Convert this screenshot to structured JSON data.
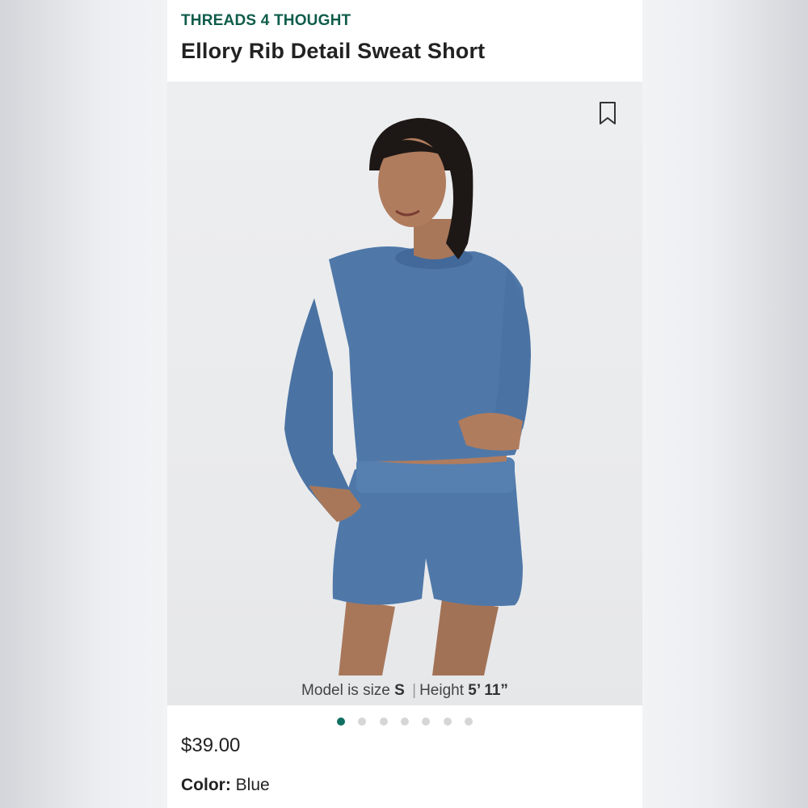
{
  "product": {
    "brand": "THREADS 4 THOUGHT",
    "title": "Ellory Rib Detail Sweat Short",
    "price": "$39.00",
    "color_label": "Color:",
    "color_value": "Blue"
  },
  "image": {
    "model_size_label": "Model is size",
    "model_size_value": "S",
    "separator": "|",
    "height_label": "Height",
    "height_value": "5’ 11”"
  },
  "carousel": {
    "total": 7,
    "active_index": 0
  },
  "icons": {
    "save": "bookmark-icon"
  },
  "colors": {
    "brand": "#0f5c4b",
    "active_dot": "#0f6f61",
    "garment": "#4f78a8"
  }
}
